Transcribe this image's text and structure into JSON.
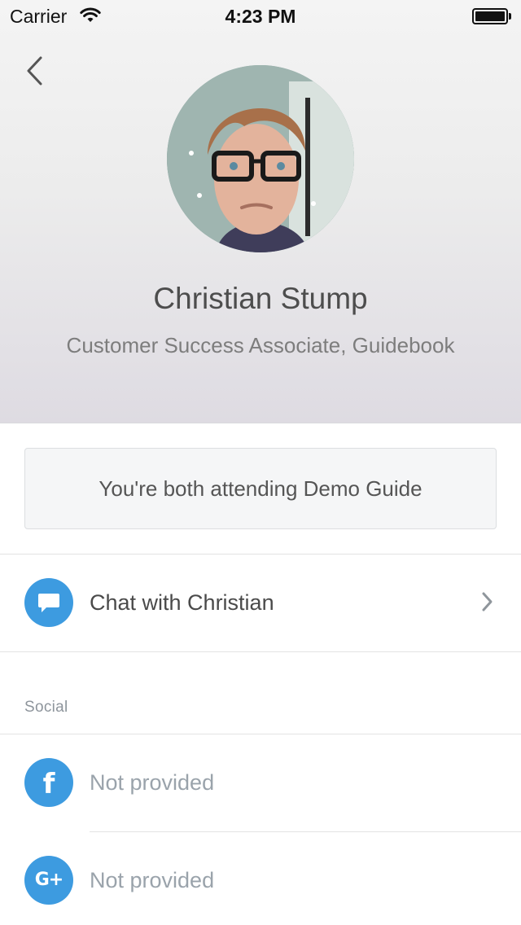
{
  "status_bar": {
    "carrier": "Carrier",
    "time": "4:23 PM"
  },
  "profile": {
    "name": "Christian Stump",
    "title": "Customer Success Associate, Guidebook"
  },
  "attending": {
    "text": "You're both attending Demo Guide"
  },
  "chat": {
    "label": "Chat with Christian",
    "icon": "chat-bubble-icon"
  },
  "social": {
    "header": "Social",
    "items": [
      {
        "icon": "facebook-icon",
        "glyph": "f",
        "label": "Not provided"
      },
      {
        "icon": "google-plus-icon",
        "glyph": "G+",
        "label": "Not provided"
      }
    ]
  },
  "colors": {
    "accent": "#3d9be0",
    "muted_text": "#9aa3ab",
    "header_gradient_top": "#f4f4f4",
    "header_gradient_bottom": "#dedbe2"
  }
}
